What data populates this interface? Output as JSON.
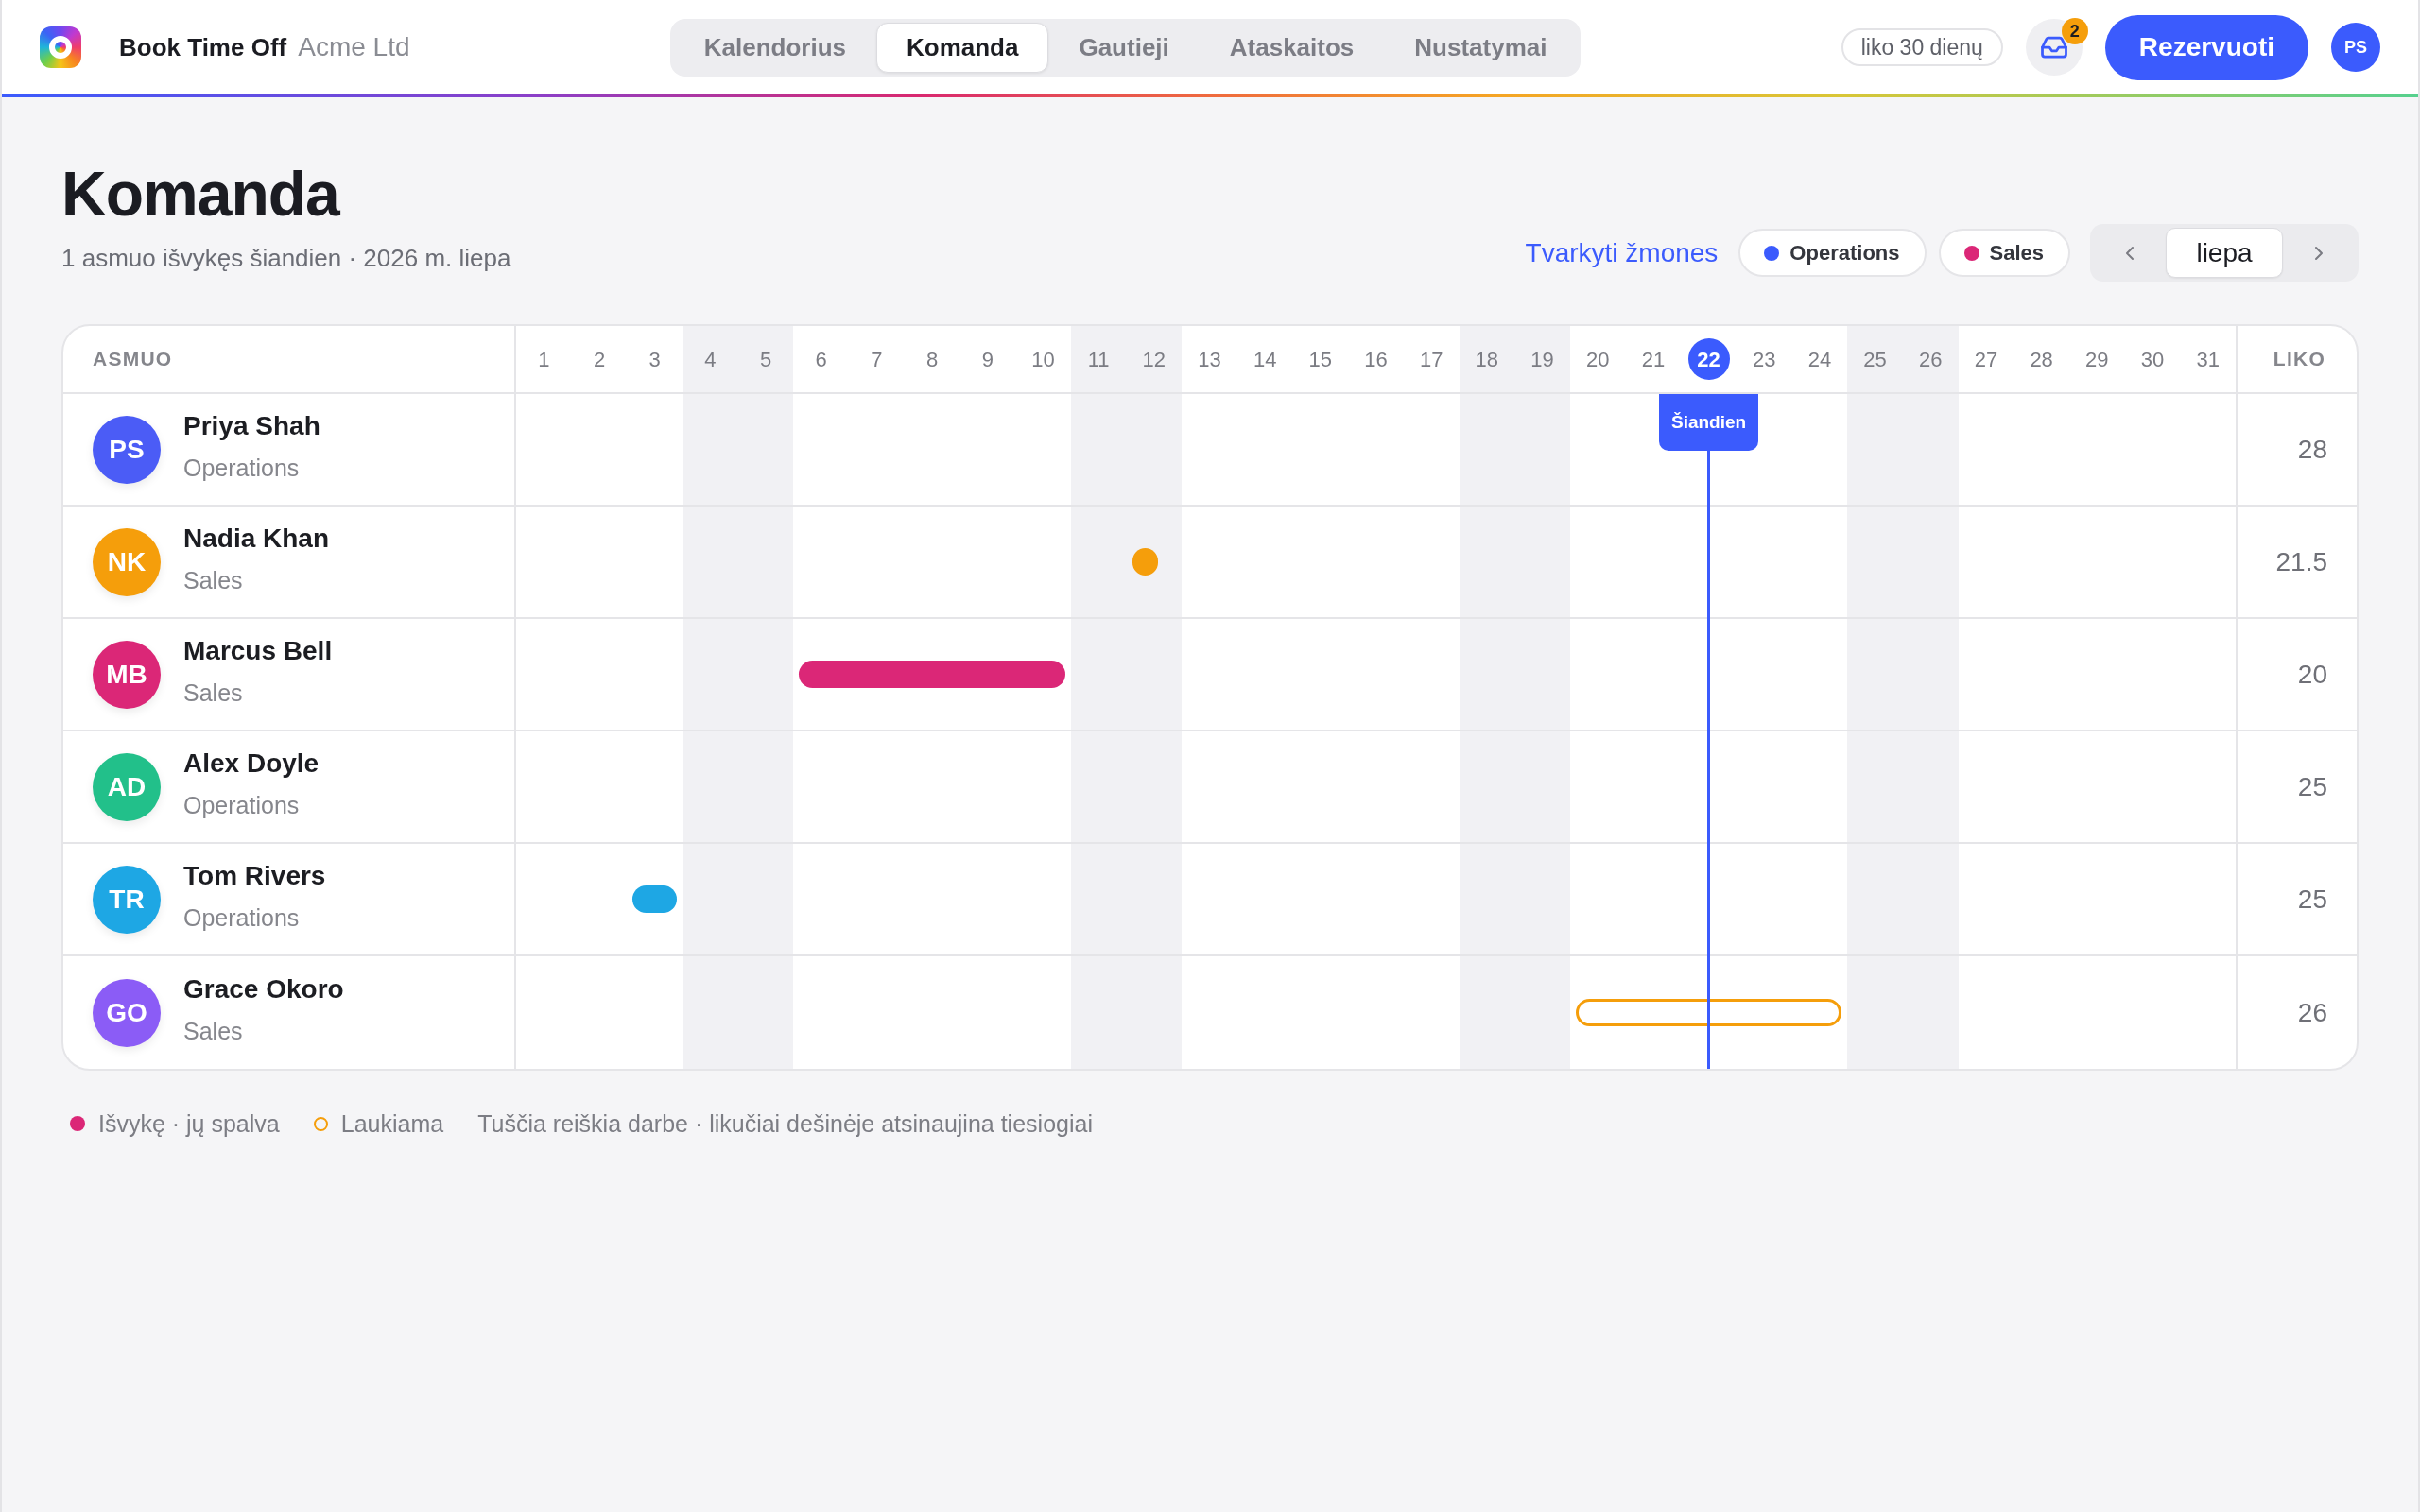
{
  "app": {
    "name": "Book Time Off",
    "org": "Acme Ltd"
  },
  "nav_tabs": [
    {
      "label": "Kalendorius",
      "selected": false
    },
    {
      "label": "Komanda",
      "selected": true
    },
    {
      "label": "Gautieji",
      "selected": false
    },
    {
      "label": "Ataskaitos",
      "selected": false
    },
    {
      "label": "Nustatymai",
      "selected": false
    }
  ],
  "header_actions": {
    "days_left": "liko 30 dienų",
    "inbox_badge": "2",
    "book_button": "Rezervuoti",
    "user_initials": "PS"
  },
  "page": {
    "title": "Komanda",
    "subtitle": "1 asmuo išvykęs šiandien · 2026 m. liepa",
    "manage_link": "Tvarkyti žmones",
    "filters": [
      {
        "label": "Operations",
        "color": "#3b5bfd"
      },
      {
        "label": "Sales",
        "color": "#db2777"
      }
    ],
    "month": "liepa"
  },
  "table": {
    "columns": {
      "person": "ASMUO",
      "remaining": "LIKO"
    },
    "days": [
      {
        "label": "1",
        "weekend": false,
        "today": false
      },
      {
        "label": "2",
        "weekend": false,
        "today": false
      },
      {
        "label": "3",
        "weekend": false,
        "today": false
      },
      {
        "label": "4",
        "weekend": true,
        "today": false
      },
      {
        "label": "5",
        "weekend": true,
        "today": false
      },
      {
        "label": "6",
        "weekend": false,
        "today": false
      },
      {
        "label": "7",
        "weekend": false,
        "today": false
      },
      {
        "label": "8",
        "weekend": false,
        "today": false
      },
      {
        "label": "9",
        "weekend": false,
        "today": false
      },
      {
        "label": "10",
        "weekend": false,
        "today": false
      },
      {
        "label": "11",
        "weekend": true,
        "today": false
      },
      {
        "label": "12",
        "weekend": true,
        "today": false
      },
      {
        "label": "13",
        "weekend": false,
        "today": false
      },
      {
        "label": "14",
        "weekend": false,
        "today": false
      },
      {
        "label": "15",
        "weekend": false,
        "today": false
      },
      {
        "label": "16",
        "weekend": false,
        "today": false
      },
      {
        "label": "17",
        "weekend": false,
        "today": false
      },
      {
        "label": "18",
        "weekend": true,
        "today": false
      },
      {
        "label": "19",
        "weekend": true,
        "today": false
      },
      {
        "label": "20",
        "weekend": false,
        "today": false
      },
      {
        "label": "21",
        "weekend": false,
        "today": false
      },
      {
        "label": "22",
        "weekend": false,
        "today": true
      },
      {
        "label": "23",
        "weekend": false,
        "today": false
      },
      {
        "label": "24",
        "weekend": false,
        "today": false
      },
      {
        "label": "25",
        "weekend": true,
        "today": false
      },
      {
        "label": "26",
        "weekend": true,
        "today": false
      },
      {
        "label": "27",
        "weekend": false,
        "today": false
      },
      {
        "label": "28",
        "weekend": false,
        "today": false
      },
      {
        "label": "29",
        "weekend": false,
        "today": false
      },
      {
        "label": "30",
        "weekend": false,
        "today": false
      },
      {
        "label": "31",
        "weekend": false,
        "today": false
      }
    ],
    "today_label": "Šiandien",
    "rows": [
      {
        "initials": "PS",
        "name": "Priya Shah",
        "team": "Operations",
        "color": "#4b5cf6",
        "remaining": "28",
        "cells": [
          {
            "kind": "free"
          },
          {
            "kind": "free"
          },
          {
            "kind": "free"
          },
          {
            "kind": "free"
          },
          {
            "kind": "free"
          },
          {
            "kind": "free"
          },
          {
            "kind": "free"
          },
          {
            "kind": "free"
          },
          {
            "kind": "free"
          },
          {
            "kind": "free"
          },
          {
            "kind": "free"
          },
          {
            "kind": "free"
          },
          {
            "kind": "free"
          },
          {
            "kind": "free"
          },
          {
            "kind": "free"
          },
          {
            "kind": "free"
          },
          {
            "kind": "free"
          },
          {
            "kind": "free"
          },
          {
            "kind": "free"
          },
          {
            "kind": "free"
          },
          {
            "kind": "free"
          },
          {
            "kind": "free"
          },
          {
            "kind": "free"
          },
          {
            "kind": "free"
          },
          {
            "kind": "free"
          },
          {
            "kind": "free"
          },
          {
            "kind": "free"
          },
          {
            "kind": "free"
          },
          {
            "kind": "free"
          },
          {
            "kind": "free"
          },
          {
            "kind": "free"
          }
        ]
      },
      {
        "initials": "NK",
        "name": "Nadia Khan",
        "team": "Sales",
        "color": "#f59e0b",
        "remaining": "21.5",
        "cells": [
          {
            "kind": "free"
          },
          {
            "kind": "free"
          },
          {
            "kind": "free"
          },
          {
            "kind": "free"
          },
          {
            "kind": "free"
          },
          {
            "kind": "free"
          },
          {
            "kind": "free"
          },
          {
            "kind": "free"
          },
          {
            "kind": "free"
          },
          {
            "kind": "free"
          },
          {
            "kind": "free"
          },
          {
            "kind": "half"
          },
          {
            "kind": "free"
          },
          {
            "kind": "free"
          },
          {
            "kind": "free"
          },
          {
            "kind": "free"
          },
          {
            "kind": "free"
          },
          {
            "kind": "free"
          },
          {
            "kind": "free"
          },
          {
            "kind": "free"
          },
          {
            "kind": "free"
          },
          {
            "kind": "free"
          },
          {
            "kind": "free"
          },
          {
            "kind": "free"
          },
          {
            "kind": "free"
          },
          {
            "kind": "free"
          },
          {
            "kind": "free"
          },
          {
            "kind": "free"
          },
          {
            "kind": "free"
          },
          {
            "kind": "free"
          },
          {
            "kind": "free"
          }
        ]
      },
      {
        "initials": "MB",
        "name": "Marcus Bell",
        "team": "Sales",
        "color": "#db2777",
        "remaining": "20",
        "cells": [
          {
            "kind": "free"
          },
          {
            "kind": "free"
          },
          {
            "kind": "free"
          },
          {
            "kind": "free"
          },
          {
            "kind": "free"
          },
          {
            "kind": "away"
          },
          {
            "kind": "away"
          },
          {
            "kind": "away"
          },
          {
            "kind": "away"
          },
          {
            "kind": "away"
          },
          {
            "kind": "free"
          },
          {
            "kind": "free"
          },
          {
            "kind": "free"
          },
          {
            "kind": "free"
          },
          {
            "kind": "free"
          },
          {
            "kind": "free"
          },
          {
            "kind": "free"
          },
          {
            "kind": "free"
          },
          {
            "kind": "free"
          },
          {
            "kind": "free"
          },
          {
            "kind": "free"
          },
          {
            "kind": "free"
          },
          {
            "kind": "free"
          },
          {
            "kind": "free"
          },
          {
            "kind": "free"
          },
          {
            "kind": "free"
          },
          {
            "kind": "free"
          },
          {
            "kind": "free"
          },
          {
            "kind": "free"
          },
          {
            "kind": "free"
          },
          {
            "kind": "free"
          }
        ]
      },
      {
        "initials": "AD",
        "name": "Alex Doyle",
        "team": "Operations",
        "color": "#22c08a",
        "remaining": "25",
        "cells": [
          {
            "kind": "free"
          },
          {
            "kind": "free"
          },
          {
            "kind": "free"
          },
          {
            "kind": "free"
          },
          {
            "kind": "free"
          },
          {
            "kind": "free"
          },
          {
            "kind": "free"
          },
          {
            "kind": "free"
          },
          {
            "kind": "free"
          },
          {
            "kind": "free"
          },
          {
            "kind": "free"
          },
          {
            "kind": "free"
          },
          {
            "kind": "free"
          },
          {
            "kind": "free"
          },
          {
            "kind": "free"
          },
          {
            "kind": "free"
          },
          {
            "kind": "free"
          },
          {
            "kind": "free"
          },
          {
            "kind": "free"
          },
          {
            "kind": "free"
          },
          {
            "kind": "free"
          },
          {
            "kind": "free"
          },
          {
            "kind": "free"
          },
          {
            "kind": "free"
          },
          {
            "kind": "free"
          },
          {
            "kind": "free"
          },
          {
            "kind": "free"
          },
          {
            "kind": "free"
          },
          {
            "kind": "free"
          },
          {
            "kind": "free"
          },
          {
            "kind": "free"
          }
        ]
      },
      {
        "initials": "TR",
        "name": "Tom Rivers",
        "team": "Operations",
        "color": "#1ea7e4",
        "remaining": "25",
        "cells": [
          {
            "kind": "free"
          },
          {
            "kind": "free"
          },
          {
            "kind": "away"
          },
          {
            "kind": "free"
          },
          {
            "kind": "free"
          },
          {
            "kind": "free"
          },
          {
            "kind": "free"
          },
          {
            "kind": "free"
          },
          {
            "kind": "free"
          },
          {
            "kind": "free"
          },
          {
            "kind": "free"
          },
          {
            "kind": "free"
          },
          {
            "kind": "free"
          },
          {
            "kind": "free"
          },
          {
            "kind": "free"
          },
          {
            "kind": "free"
          },
          {
            "kind": "free"
          },
          {
            "kind": "free"
          },
          {
            "kind": "free"
          },
          {
            "kind": "free"
          },
          {
            "kind": "free"
          },
          {
            "kind": "free"
          },
          {
            "kind": "free"
          },
          {
            "kind": "free"
          },
          {
            "kind": "free"
          },
          {
            "kind": "free"
          },
          {
            "kind": "free"
          },
          {
            "kind": "free"
          },
          {
            "kind": "free"
          },
          {
            "kind": "free"
          },
          {
            "kind": "free"
          }
        ]
      },
      {
        "initials": "GO",
        "name": "Grace Okoro",
        "team": "Sales",
        "color": "#8b5cf6",
        "remaining": "26",
        "cells": [
          {
            "kind": "free"
          },
          {
            "kind": "free"
          },
          {
            "kind": "free"
          },
          {
            "kind": "free"
          },
          {
            "kind": "free"
          },
          {
            "kind": "free"
          },
          {
            "kind": "free"
          },
          {
            "kind": "free"
          },
          {
            "kind": "free"
          },
          {
            "kind": "free"
          },
          {
            "kind": "free"
          },
          {
            "kind": "free"
          },
          {
            "kind": "free"
          },
          {
            "kind": "free"
          },
          {
            "kind": "free"
          },
          {
            "kind": "free"
          },
          {
            "kind": "free"
          },
          {
            "kind": "free"
          },
          {
            "kind": "free"
          },
          {
            "kind": "pending"
          },
          {
            "kind": "pending"
          },
          {
            "kind": "pending"
          },
          {
            "kind": "pending"
          },
          {
            "kind": "pending"
          },
          {
            "kind": "free"
          },
          {
            "kind": "free"
          },
          {
            "kind": "free"
          },
          {
            "kind": "free"
          },
          {
            "kind": "free"
          },
          {
            "kind": "free"
          },
          {
            "kind": "free"
          }
        ]
      }
    ]
  },
  "legend": [
    {
      "kind": "away",
      "label": "Išvykę · jų spalva",
      "color": "#db2777"
    },
    {
      "kind": "pending",
      "label": "Laukiama",
      "color": "#f59e0b"
    },
    {
      "kind": "note",
      "label": "Tuščia reiškia darbe · likučiai dešinėje atsinaujina tiesiogiai"
    }
  ]
}
